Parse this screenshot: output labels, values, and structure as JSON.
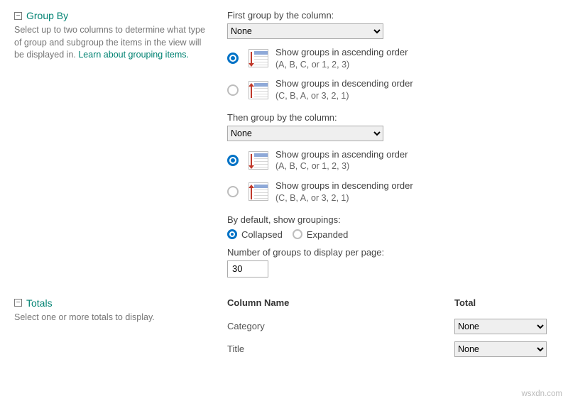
{
  "groupBy": {
    "title": "Group By",
    "description": "Select up to two columns to determine what type of group and subgroup the items in the view will be displayed in. ",
    "learnLink": "Learn about grouping items.",
    "first": {
      "label": "First group by the column:",
      "selected": "None",
      "asc": {
        "l1": "Show groups in ascending order",
        "l2": "(A, B, C, or 1, 2, 3)"
      },
      "desc": {
        "l1": "Show groups in descending order",
        "l2": "(C, B, A, or 3, 2, 1)"
      }
    },
    "then": {
      "label": "Then group by the column:",
      "selected": "None",
      "asc": {
        "l1": "Show groups in ascending order",
        "l2": "(A, B, C, or 1, 2, 3)"
      },
      "desc": {
        "l1": "Show groups in descending order",
        "l2": "(C, B, A, or 3, 2, 1)"
      }
    },
    "defaultLabel": "By default, show groupings:",
    "collapsed": "Collapsed",
    "expanded": "Expanded",
    "perPageLabel": "Number of groups to display per page:",
    "perPageValue": "30"
  },
  "totals": {
    "title": "Totals",
    "description": "Select one or more totals to display.",
    "colHeader": "Column Name",
    "totalHeader": "Total",
    "rows": [
      {
        "name": "Category",
        "value": "None"
      },
      {
        "name": "Title",
        "value": "None"
      }
    ]
  },
  "watermark": "wsxdn.com"
}
